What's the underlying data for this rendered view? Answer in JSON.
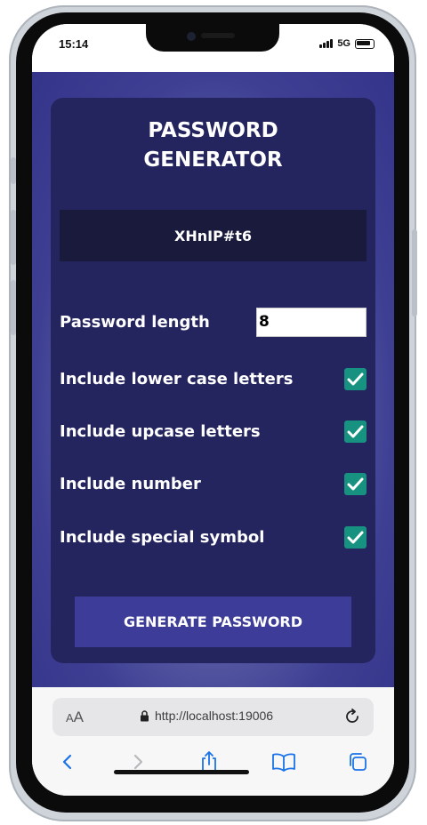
{
  "status_bar": {
    "time": "15:14",
    "network": "5G"
  },
  "app": {
    "title_line1": "PASSWORD",
    "title_line2": "GENERATOR",
    "password": "XHnIP#t6",
    "length_label": "Password length",
    "length_value": "8",
    "options": [
      {
        "label": "Include lower case letters",
        "checked": true
      },
      {
        "label": "Include upcase letters",
        "checked": true
      },
      {
        "label": "Include number",
        "checked": true
      },
      {
        "label": "Include special symbol",
        "checked": true
      }
    ],
    "generate_label": "GENERATE PASSWORD"
  },
  "browser": {
    "text_size_label": "AA",
    "url": "http://localhost:19006"
  },
  "colors": {
    "card": "#24245e",
    "result_box": "#1a1a3d",
    "checkbox": "#179281",
    "button": "#3d3d99",
    "ios_blue": "#1a73e8"
  }
}
